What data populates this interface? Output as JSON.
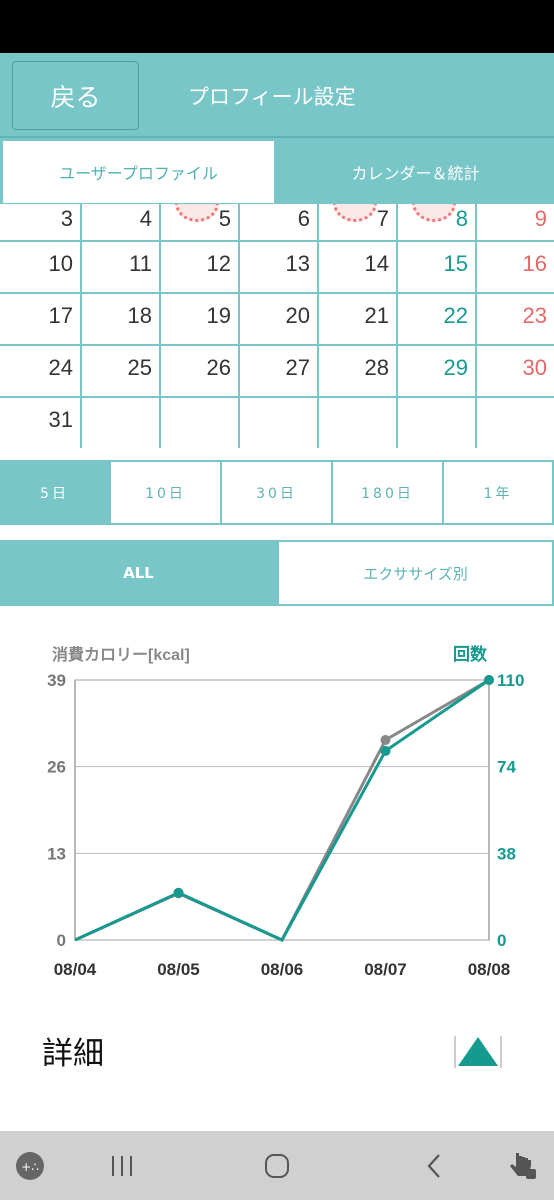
{
  "header": {
    "back_label": "戻る",
    "title": "プロフィール設定"
  },
  "tabs": [
    {
      "label": "ユーザープロファイル",
      "active": true
    },
    {
      "label": "カレンダー＆統計",
      "active": false
    }
  ],
  "calendar": {
    "rows": [
      [
        "3",
        "4",
        "5",
        "6",
        "7",
        "8",
        "9"
      ],
      [
        "10",
        "11",
        "12",
        "13",
        "14",
        "15",
        "16"
      ],
      [
        "17",
        "18",
        "19",
        "20",
        "21",
        "22",
        "23"
      ],
      [
        "24",
        "25",
        "26",
        "27",
        "28",
        "29",
        "30"
      ],
      [
        "31",
        "",
        "",
        "",
        "",
        "",
        ""
      ]
    ],
    "stamped_days": [
      "5",
      "7",
      "8"
    ]
  },
  "periods": [
    {
      "label": "5日",
      "active": true
    },
    {
      "label": "10日",
      "active": false
    },
    {
      "label": "30日",
      "active": false
    },
    {
      "label": "180日",
      "active": false
    },
    {
      "label": "1年",
      "active": false
    }
  ],
  "modes": [
    {
      "label": "ALL",
      "active": true
    },
    {
      "label": "エクササイズ別",
      "active": false
    }
  ],
  "chart_data": {
    "type": "line",
    "categories": [
      "08/04",
      "08/05",
      "08/06",
      "08/07",
      "08/08"
    ],
    "y_left": {
      "label": "消費カロリー[kcal]",
      "ticks": [
        "0",
        "13",
        "26",
        "39"
      ],
      "range": [
        0,
        39
      ]
    },
    "y_right": {
      "label": "回数",
      "ticks": [
        "0",
        "38",
        "74",
        "110"
      ],
      "range": [
        0,
        110
      ]
    },
    "series": [
      {
        "axis": "left",
        "color": "#888888",
        "values": [
          0,
          7,
          0,
          30,
          39
        ]
      },
      {
        "axis": "right",
        "color": "#16998f",
        "values": [
          0,
          20,
          0,
          80,
          110
        ]
      }
    ],
    "grid": true
  },
  "detail": {
    "label": "詳細"
  },
  "colors": {
    "accent": "#78c6c8",
    "teal": "#16998f",
    "sunday": "#e06a6a"
  }
}
